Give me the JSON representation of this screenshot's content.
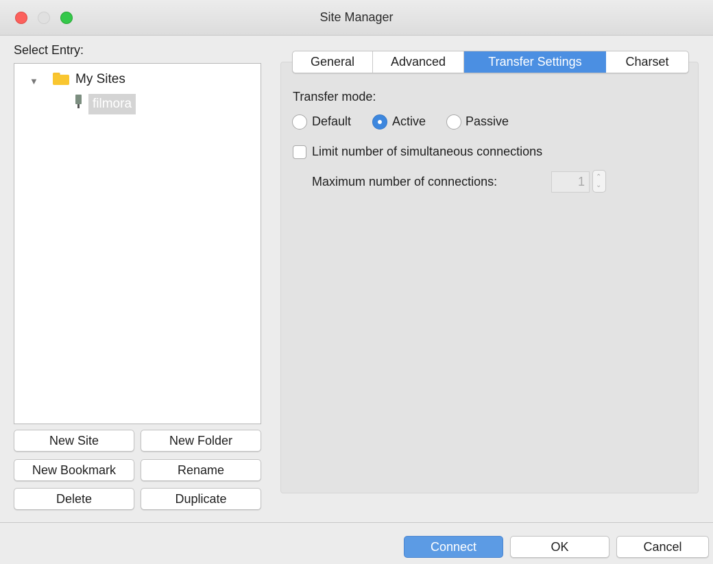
{
  "window": {
    "title": "Site Manager"
  },
  "sidebar": {
    "label": "Select Entry:",
    "tree": {
      "folder": {
        "label": "My Sites",
        "icon": "folder-icon",
        "expanded": true
      },
      "site": {
        "label": "filmora",
        "icon": "server-icon",
        "selected": true
      }
    },
    "buttons": {
      "new_site": "New Site",
      "new_folder": "New Folder",
      "new_bookmark": "New Bookmark",
      "rename": "Rename",
      "delete": "Delete",
      "duplicate": "Duplicate"
    }
  },
  "tabs": [
    {
      "label": "General",
      "active": false
    },
    {
      "label": "Advanced",
      "active": false
    },
    {
      "label": "Transfer Settings",
      "active": true
    },
    {
      "label": "Charset",
      "active": false
    }
  ],
  "transfer": {
    "mode_label": "Transfer mode:",
    "modes": [
      {
        "label": "Default",
        "checked": false
      },
      {
        "label": "Active",
        "checked": true
      },
      {
        "label": "Passive",
        "checked": false
      }
    ],
    "limit_label": "Limit number of simultaneous connections",
    "limit_checked": false,
    "max_label": "Maximum number of connections:",
    "max_value": "1"
  },
  "footer": {
    "connect": "Connect",
    "ok": "OK",
    "cancel": "Cancel"
  },
  "colors": {
    "accent": "#4b8fe2",
    "primary_button": "#5c9be4",
    "close": "#fc605c",
    "maximize": "#34c84a",
    "folder": "#f9c630"
  }
}
